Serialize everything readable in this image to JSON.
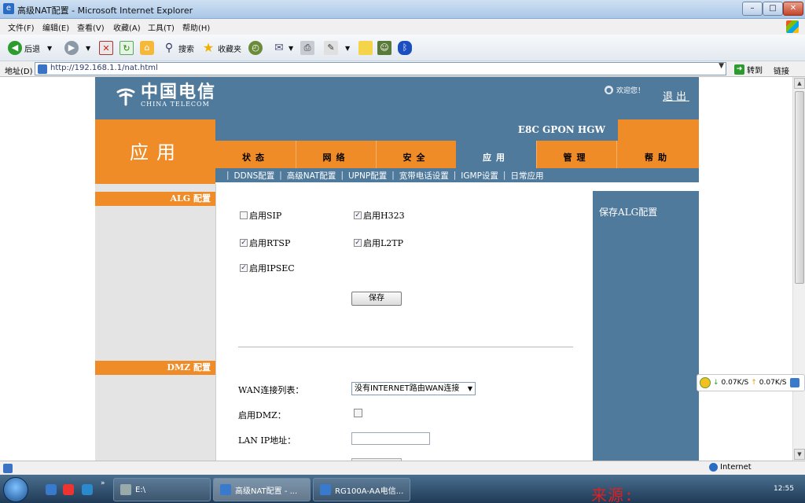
{
  "window": {
    "title": "高级NAT配置 - Microsoft Internet Explorer",
    "buttons": {
      "minimize": "–",
      "maximize": "□",
      "close": "✕"
    }
  },
  "menu": [
    "文件(F)",
    "编辑(E)",
    "查看(V)",
    "收藏(A)",
    "工具(T)",
    "帮助(H)"
  ],
  "toolbar": {
    "back": "后退",
    "search": "搜索",
    "favorites": "收藏夹"
  },
  "address": {
    "label": "地址(D)",
    "url": "http://192.168.1.1/nat.html",
    "go": "转到",
    "links": "链接"
  },
  "router": {
    "brand_cn": "中国电信",
    "brand_en": "CHINA TELECOM",
    "welcome": "欢迎您！",
    "logout": "退出",
    "model": "E8C GPON HGW",
    "section_title": "应用",
    "tabs": [
      {
        "label": "状态",
        "active": false
      },
      {
        "label": "网络",
        "active": false
      },
      {
        "label": "安全",
        "active": false
      },
      {
        "label": "应用",
        "active": true
      },
      {
        "label": "管理",
        "active": false
      },
      {
        "label": "帮助",
        "active": false
      }
    ],
    "subnav": [
      "DDNS配置",
      "高级NAT配置",
      "UPNP配置",
      "宽带电话设置",
      "IGMP设置",
      "日常应用"
    ],
    "alg_section": "ALG 配置",
    "dmz_section": "DMZ 配置",
    "alg_options": [
      {
        "label": "启用SIP",
        "checked": false
      },
      {
        "label": "启用H323",
        "checked": true
      },
      {
        "label": "启用RTSP",
        "checked": true
      },
      {
        "label": "启用L2TP",
        "checked": true
      },
      {
        "label": "启用IPSEC",
        "checked": true
      }
    ],
    "save_button": "保存",
    "help_text": "保存ALG配置",
    "dmz": {
      "wan_label": "WAN连接列表：",
      "wan_value": "没有INTERNET路由WAN连接",
      "enable_label": "启用DMZ：",
      "enable_checked": false,
      "lan_ip_label": "LAN IP地址：",
      "lan_ip_value": ""
    }
  },
  "netspeed": {
    "down": "0.07K/S",
    "up": "0.07K/S"
  },
  "statusbar": {
    "zone": "Internet"
  },
  "taskbar": {
    "items": [
      {
        "label": "E:\\",
        "active": false
      },
      {
        "label": "高级NAT配置 - ...",
        "active": true
      },
      {
        "label": "RG100A-AA电信...",
        "active": false
      }
    ],
    "watermark": "来源: http://hctoro.com",
    "clock": "12:55"
  }
}
